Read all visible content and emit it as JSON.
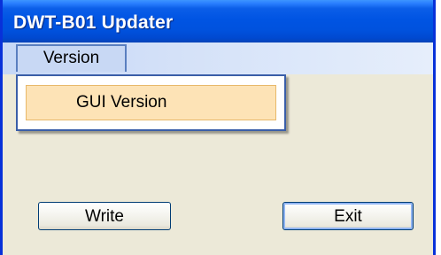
{
  "window": {
    "title": "DWT-B01 Updater"
  },
  "menubar": {
    "items": [
      {
        "label": "Version"
      }
    ]
  },
  "dropdown": {
    "items": [
      {
        "label": "GUI Version"
      }
    ]
  },
  "buttons": {
    "write_label": "Write",
    "exit_label": "Exit"
  },
  "colors": {
    "titlebar": "#0054e3",
    "window_body": "#ece9d8",
    "menu_highlight": "#fde3b6"
  }
}
